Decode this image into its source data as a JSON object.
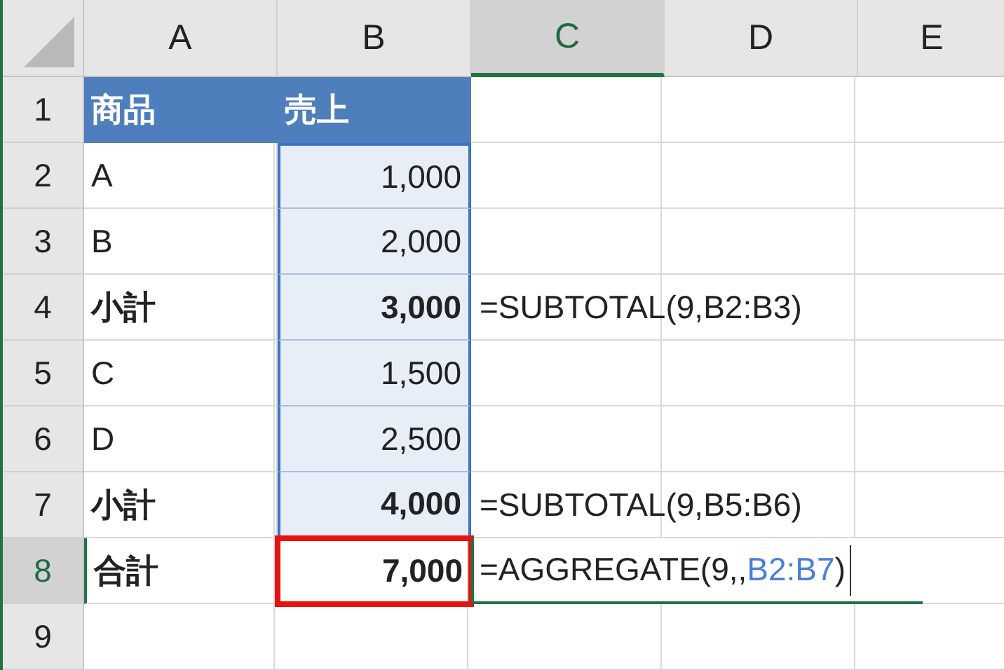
{
  "columns": [
    {
      "label": "A",
      "selected": false
    },
    {
      "label": "B",
      "selected": false
    },
    {
      "label": "C",
      "selected": true
    },
    {
      "label": "D",
      "selected": false
    },
    {
      "label": "E",
      "selected": false
    }
  ],
  "rows": [
    {
      "number": "1",
      "selected": false,
      "kind": "header",
      "a": "商品",
      "b": "売上",
      "b_in_range": false,
      "b_highlighted": false,
      "c": []
    },
    {
      "number": "2",
      "selected": false,
      "kind": "item",
      "a": "A",
      "b": "1,000",
      "b_in_range": true,
      "b_highlighted": false,
      "c": []
    },
    {
      "number": "3",
      "selected": false,
      "kind": "item",
      "a": "B",
      "b": "2,000",
      "b_in_range": true,
      "b_highlighted": false,
      "c": []
    },
    {
      "number": "4",
      "selected": false,
      "kind": "subtotal",
      "a": "小計",
      "b": "3,000",
      "b_in_range": true,
      "b_highlighted": false,
      "c": [
        {
          "text": "=SUBTOTAL(9,B2:B3)",
          "kind": "plain"
        }
      ]
    },
    {
      "number": "5",
      "selected": false,
      "kind": "item",
      "a": "C",
      "b": "1,500",
      "b_in_range": true,
      "b_highlighted": false,
      "c": []
    },
    {
      "number": "6",
      "selected": false,
      "kind": "item",
      "a": "D",
      "b": "2,500",
      "b_in_range": true,
      "b_highlighted": false,
      "c": []
    },
    {
      "number": "7",
      "selected": false,
      "kind": "subtotal",
      "a": "小計",
      "b": "4,000",
      "b_in_range": true,
      "b_highlighted": false,
      "c": [
        {
          "text": "=SUBTOTAL(9,B5:B6)",
          "kind": "plain"
        }
      ]
    },
    {
      "number": "8",
      "selected": true,
      "kind": "total",
      "a": "合計",
      "b": "7,000",
      "b_in_range": false,
      "b_highlighted": true,
      "c": [
        {
          "text": "=AGGREGATE(9,,",
          "kind": "plain"
        },
        {
          "text": "B2:B7",
          "kind": "ref"
        },
        {
          "text": ")",
          "kind": "plain"
        }
      ]
    },
    {
      "number": "9",
      "selected": false,
      "c": []
    }
  ]
}
